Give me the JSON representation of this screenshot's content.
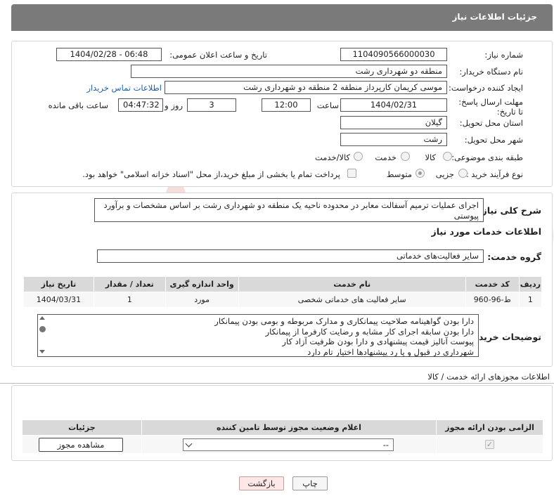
{
  "header": {
    "title": "جزئیات اطلاعات نیاز"
  },
  "fields": {
    "need_number_label": "شماره نیاز:",
    "need_number": "1104090566000030",
    "announce_label": "تاریخ و ساعت اعلان عمومی:",
    "announce_value": "1404/02/28 - 06:48",
    "buyer_org_label": "نام دستگاه خریدار:",
    "buyer_org": "منطقه دو شهرداری رشت",
    "creator_label": "ایجاد کننده درخواست:",
    "creator": "موسی کریمان کارپرداز منطقه 2 منطقه دو شهرداری رشت",
    "contact_link": "اطلاعات تماس خریدار",
    "deadline_label": "مهلت ارسال پاسخ: تا تاریخ:",
    "deadline_date": "1404/02/31",
    "time_label": "ساعت",
    "deadline_time": "12:00",
    "days_value": "3",
    "days_label": "روز و",
    "remaining_time": "04:47:32",
    "remaining_label": "ساعت باقی مانده",
    "province_label": "استان محل تحویل:",
    "province": "گیلان",
    "city_label": "شهر محل تحویل:",
    "city": "رشت",
    "category_label": "طبقه بندی موضوعی:",
    "category_options": [
      "کالا",
      "خدمت",
      "کالا/خدمت"
    ],
    "process_label": "نوع فرآیند خرید :",
    "process_options": [
      "جزیی",
      "متوسط"
    ],
    "payment_note": "پرداخت تمام یا بخشی از مبلغ خرید،از محل \"اسناد خزانه اسلامی\" خواهد بود."
  },
  "summary": {
    "label": "شرح کلی نیاز:",
    "text": "اجرای عملیات ترمیم آسفالت معابر در محدوده ناحیه یک منطقه دو شهرداری رشت بر اساس مشخصات و برآورد پیوستی"
  },
  "services": {
    "section_title": "اطلاعات خدمات مورد نیاز",
    "group_label": "گروه خدمت:",
    "group_value": "سایر فعالیت‌های خدماتی",
    "columns": [
      "ردیف",
      "کد خدمت",
      "نام خدمت",
      "واحد اندازه گیری",
      "تعداد / مقدار",
      "تاریخ نیاز"
    ],
    "rows": [
      [
        "1",
        "ط-96-960",
        "سایر فعالیت های خدماتی شخصی",
        "مورد",
        "1",
        "1404/03/31"
      ]
    ]
  },
  "buyer_notes": {
    "label": "توضیحات خریدار:",
    "lines": [
      "دارا بودن گواهینامه صلاحیت پیمانکاری و مدارک مربوطه و بومی بودن پیمانکار",
      "دارا بودن سابقه اجرای کار مشابه و رضایت کارفرما از پیمانکار",
      "پیوست آنالیز قیمت پیشنهادی و دارا بودن ظرفیت آزاد کار",
      "شهرداری در قبول و یا رد پیشنهادها اختیار تام دارد"
    ]
  },
  "permits": {
    "section_title": "اطلاعات مجوزهای ارائه خدمت / کالا",
    "columns": [
      "الزامی بودن ارائه مجوز",
      "اعلام وضعیت مجوز توسط تامین کننده",
      "جزئیات"
    ],
    "select_value": "--",
    "view_button": "مشاهده مجوز"
  },
  "footer": {
    "print_button": "چاپ",
    "back_button": "بازگشت"
  },
  "watermark_text": "AriaTender.neT"
}
